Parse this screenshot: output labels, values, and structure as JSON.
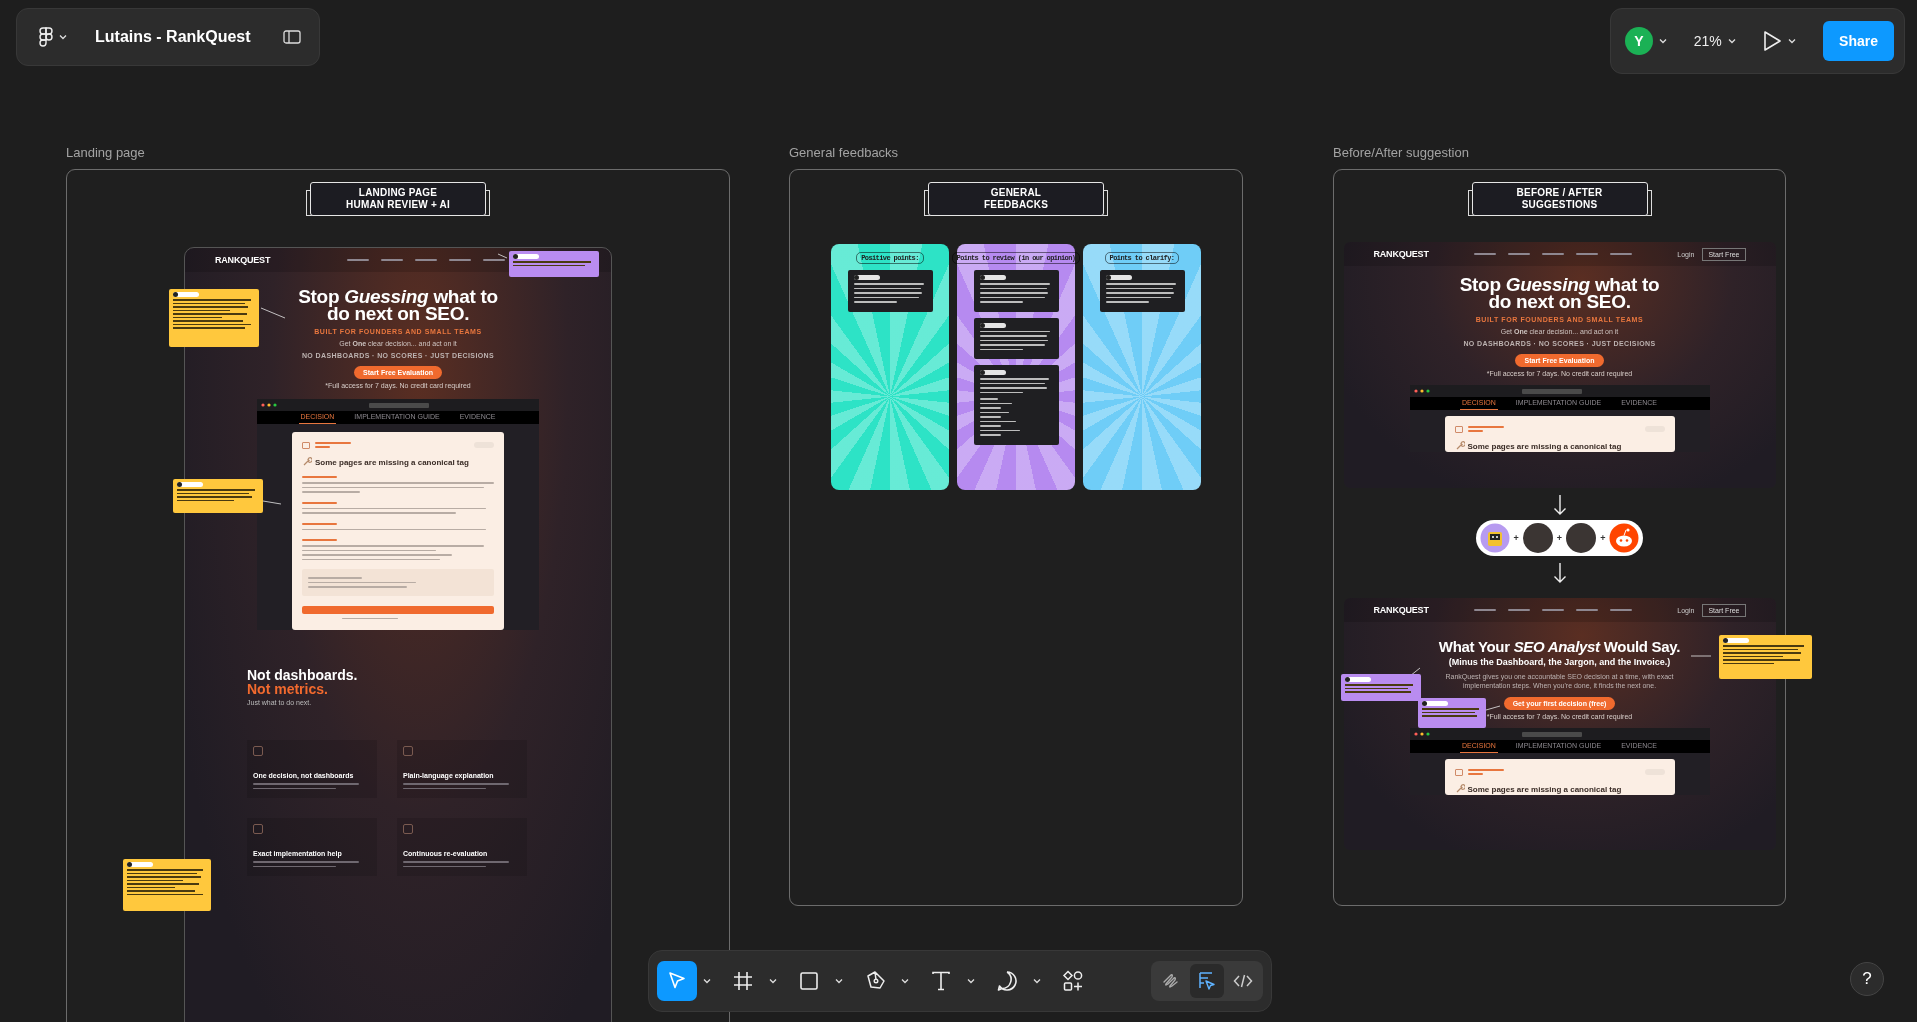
{
  "header": {
    "file_name": "Lutains - RankQuest",
    "user_initial": "Y",
    "zoom": "21%",
    "share": "Share"
  },
  "frames": [
    {
      "kind": "landing",
      "label": "Landing page",
      "banner": [
        "LANDING PAGE",
        "HUMAN REVIEW + AI"
      ],
      "mock": {
        "logo": "**R**ANKQUEST",
        "headline": "Stop *Guessing* what to do next on **SEO**.",
        "eyebrow": "BUILT FOR FOUNDERS AND SMALL TEAMS",
        "subhead": "Get **One** clear decision... and act on it",
        "tags": "NO DASHBOARDS · NO SCORES · JUST DECISIONS",
        "cta": "Start Free Evaluation",
        "note": "*Full access for 7 days. No credit card required",
        "app": {
          "kind": "full",
          "tabs": [
            {
              "label": "DECISION",
              "selected": true
            },
            {
              "label": "IMPLEMENTATION GUIDE",
              "selected": false
            },
            {
              "label": "EVIDENCE",
              "selected": false
            }
          ],
          "card_title": "Some pages are missing a canonical tag"
        },
        "section": {
          "title": "Not dashboards.",
          "title_accent": "Not metrics.",
          "sub": "Just what to do next.",
          "features": [
            "One decision, not dashboards",
            "Plain-language explanation",
            "Exact implementation help",
            "Continuous re-evaluation"
          ]
        }
      },
      "notes": [
        {
          "color": "#ffc83d"
        },
        {
          "color": "#ffc83d"
        },
        {
          "color": "#b98cf0"
        },
        {
          "color": "#ffc83d"
        }
      ]
    },
    {
      "kind": "feedback",
      "label": "General feedbacks",
      "banner": [
        "GENERAL",
        "FEEDBACKS"
      ],
      "columns": [
        {
          "title": "Positive points:",
          "color": "#2de3c6",
          "cards": [
            {
              "kind": "text"
            }
          ]
        },
        {
          "title": "Points to review (in our opinion)",
          "color": "#b68af0",
          "cards": [
            {
              "kind": "text"
            },
            {
              "kind": "text"
            },
            {
              "kind": "list"
            }
          ]
        },
        {
          "title": "Points to clarify:",
          "color": "#6fcdf7",
          "cards": [
            {
              "kind": "text"
            }
          ]
        }
      ]
    },
    {
      "kind": "compare",
      "label": "Before/After suggestion",
      "banner": [
        "BEFORE / AFTER",
        "SUGGESTIONS"
      ],
      "before": {
        "logo": "**R**ANKQUEST",
        "login": "Login",
        "start": "Start Free",
        "headline": "Stop *Guessing* what to do next on **SEO**.",
        "eyebrow": "BUILT FOR FOUNDERS AND SMALL TEAMS",
        "subhead": "Get **One** clear decision... and act on it",
        "tags": "NO DASHBOARDS · NO SCORES · JUST DECISIONS",
        "cta": "Start Free Evaluation",
        "note": "*Full access for 7 days. No credit card required",
        "app": {
          "kind": "header",
          "tabs": [
            {
              "label": "DECISION",
              "selected": true
            },
            {
              "label": "IMPLEMENTATION GUIDE",
              "selected": false
            },
            {
              "label": "EVIDENCE",
              "selected": false
            }
          ],
          "card_title": "Some pages are missing a canonical tag"
        }
      },
      "avatars": [
        {
          "kind": "robot"
        },
        {
          "kind": "person",
          "prefix": "+"
        },
        {
          "kind": "person",
          "prefix": "+"
        },
        {
          "kind": "mascot",
          "prefix": "+"
        }
      ],
      "after": {
        "logo": "**R**ANKQUEST",
        "login": "Login",
        "start": "Start Free",
        "headline": "What Your *SEO Analyst* Would Say.",
        "headline2": "(Minus the Dashboard, the Jargon, and the Invoice.)",
        "body": "RankQuest gives you one accountable SEO decision at a time, with exact implementation steps. When you're done, it finds the next one.",
        "cta": "Get your first decision (free)",
        "note": "*Full access for 7 days. No credit card required",
        "app": {
          "kind": "header",
          "tabs": [
            {
              "label": "DECISION",
              "selected": true
            },
            {
              "label": "IMPLEMENTATION GUIDE",
              "selected": false
            },
            {
              "label": "EVIDENCE",
              "selected": false
            }
          ],
          "card_title": "Some pages are missing a canonical tag"
        }
      },
      "notes": [
        {
          "color": "#b98cf0"
        },
        {
          "color": "#b98cf0"
        },
        {
          "color": "#ffc83d"
        }
      ]
    }
  ],
  "tools": [
    {
      "kind": "move",
      "selected": true,
      "has_menu": true
    },
    {
      "kind": "frame",
      "selected": false,
      "has_menu": true
    },
    {
      "kind": "rectangle",
      "selected": false,
      "has_menu": true
    },
    {
      "kind": "pen",
      "selected": false,
      "has_menu": true
    },
    {
      "kind": "text",
      "selected": false,
      "has_menu": true
    },
    {
      "kind": "comment",
      "selected": false,
      "has_menu": true
    },
    {
      "kind": "actions",
      "selected": false,
      "has_menu": false
    }
  ],
  "modes": [
    {
      "kind": "draw",
      "selected": false
    },
    {
      "kind": "design",
      "selected": true
    },
    {
      "kind": "dev",
      "selected": false
    }
  ],
  "help": "?"
}
